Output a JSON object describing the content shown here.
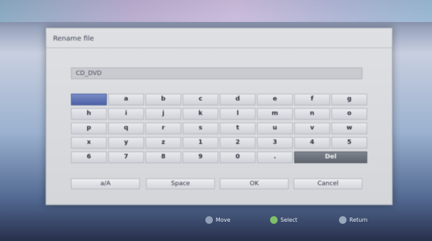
{
  "dialog": {
    "title": "Rename file"
  },
  "input": {
    "value": "CD_DVD"
  },
  "keyboard": {
    "rows": [
      [
        "",
        "a",
        "b",
        "c",
        "d",
        "e",
        "f",
        "g"
      ],
      [
        "h",
        "i",
        "j",
        "k",
        "l",
        "m",
        "n",
        "o"
      ],
      [
        "p",
        "q",
        "r",
        "s",
        "t",
        "u",
        "v",
        "w"
      ],
      [
        "x",
        "y",
        "z",
        "1",
        "2",
        "3",
        "4",
        "5"
      ],
      [
        "6",
        "7",
        "8",
        "9",
        "0",
        ".",
        "Del"
      ]
    ]
  },
  "actions": [
    "a/A",
    "Space",
    "OK",
    "Cancel"
  ],
  "hints": [
    {
      "label": "Move",
      "color": "#8fa0b8"
    },
    {
      "label": "Select",
      "color": "#7fbf6a"
    },
    {
      "label": "Return",
      "color": "#9aa7bd"
    }
  ]
}
